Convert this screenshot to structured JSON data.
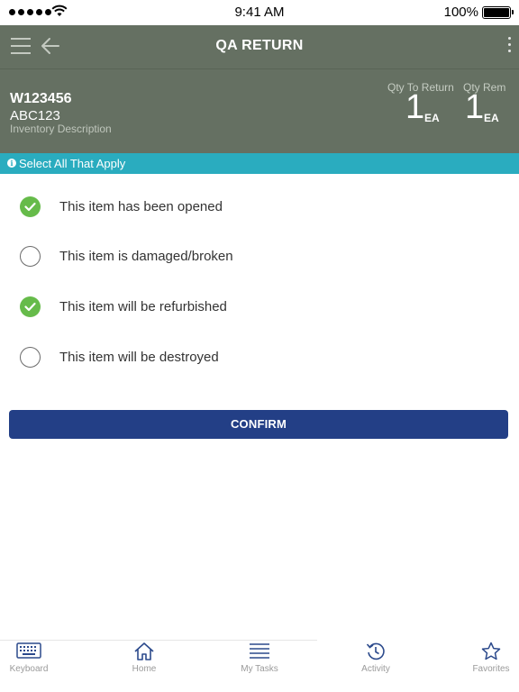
{
  "status_bar": {
    "time": "9:41 AM",
    "battery": "100%"
  },
  "nav": {
    "title": "QA RETURN",
    "menu_icon": "hamburger-menu-icon",
    "back_icon": "arrow-left-icon",
    "more_icon": "vertical-ellipsis-icon"
  },
  "item": {
    "code": "W123456",
    "sub": "ABC123",
    "description": "Inventory Description",
    "qty_to_return": {
      "label": "Qty To Return",
      "value": "1",
      "unit": "EA"
    },
    "qty_rem": {
      "label": "Qty Rem",
      "value": "1",
      "unit": "EA"
    }
  },
  "info": {
    "text": "Select All That Apply",
    "icon": "info-icon"
  },
  "options": [
    {
      "label": "This item has been opened",
      "checked": true
    },
    {
      "label": "This item is damaged/broken",
      "checked": false
    },
    {
      "label": "This item will be refurbished",
      "checked": true
    },
    {
      "label": "This item will be destroyed",
      "checked": false
    }
  ],
  "confirm_label": "CONFIRM",
  "tabs": [
    {
      "label": "Keyboard",
      "icon": "keyboard-icon"
    },
    {
      "label": "Home",
      "icon": "home-icon"
    },
    {
      "label": "My Tasks",
      "icon": "list-icon"
    },
    {
      "label": "Activity",
      "icon": "history-icon"
    },
    {
      "label": "Favorites",
      "icon": "star-icon"
    }
  ],
  "colors": {
    "header": "#657062",
    "info_bar": "#2aacbf",
    "check_on": "#66bb4a",
    "button": "#233f86",
    "tab_icon": "#2c4a8c"
  }
}
